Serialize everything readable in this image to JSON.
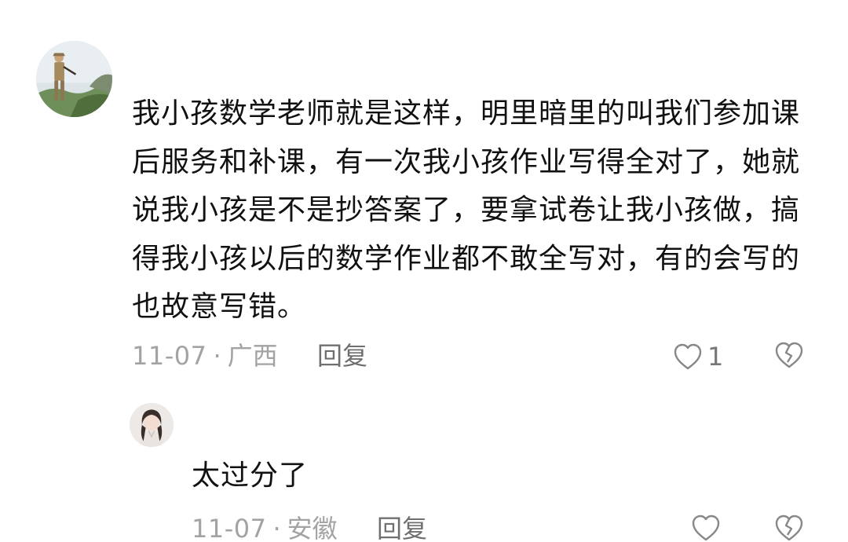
{
  "comment": {
    "text": "我小孩数学老师就是这样，明里暗里的叫我们参加课后服务和补课，有一次我小孩作业写得全对了，她就说我小孩是不是抄答案了，要拿试卷让我小孩做，搞得我小孩以后的数学作业都不敢全写对，有的会写的也故意写错。",
    "date": "11-07",
    "separator": "·",
    "location": "广西",
    "reply_label": "回复",
    "like_count": "1",
    "like_icon": "heart-outline-icon",
    "dislike_icon": "broken-heart-icon"
  },
  "reply": {
    "text": "太过分了",
    "date": "11-07",
    "separator": "·",
    "location": "安徽",
    "reply_label": "回复",
    "like_icon": "heart-outline-icon",
    "dislike_icon": "broken-heart-icon"
  },
  "colors": {
    "text": "#111111",
    "meta": "#a3a3a3",
    "icon": "#888888"
  }
}
